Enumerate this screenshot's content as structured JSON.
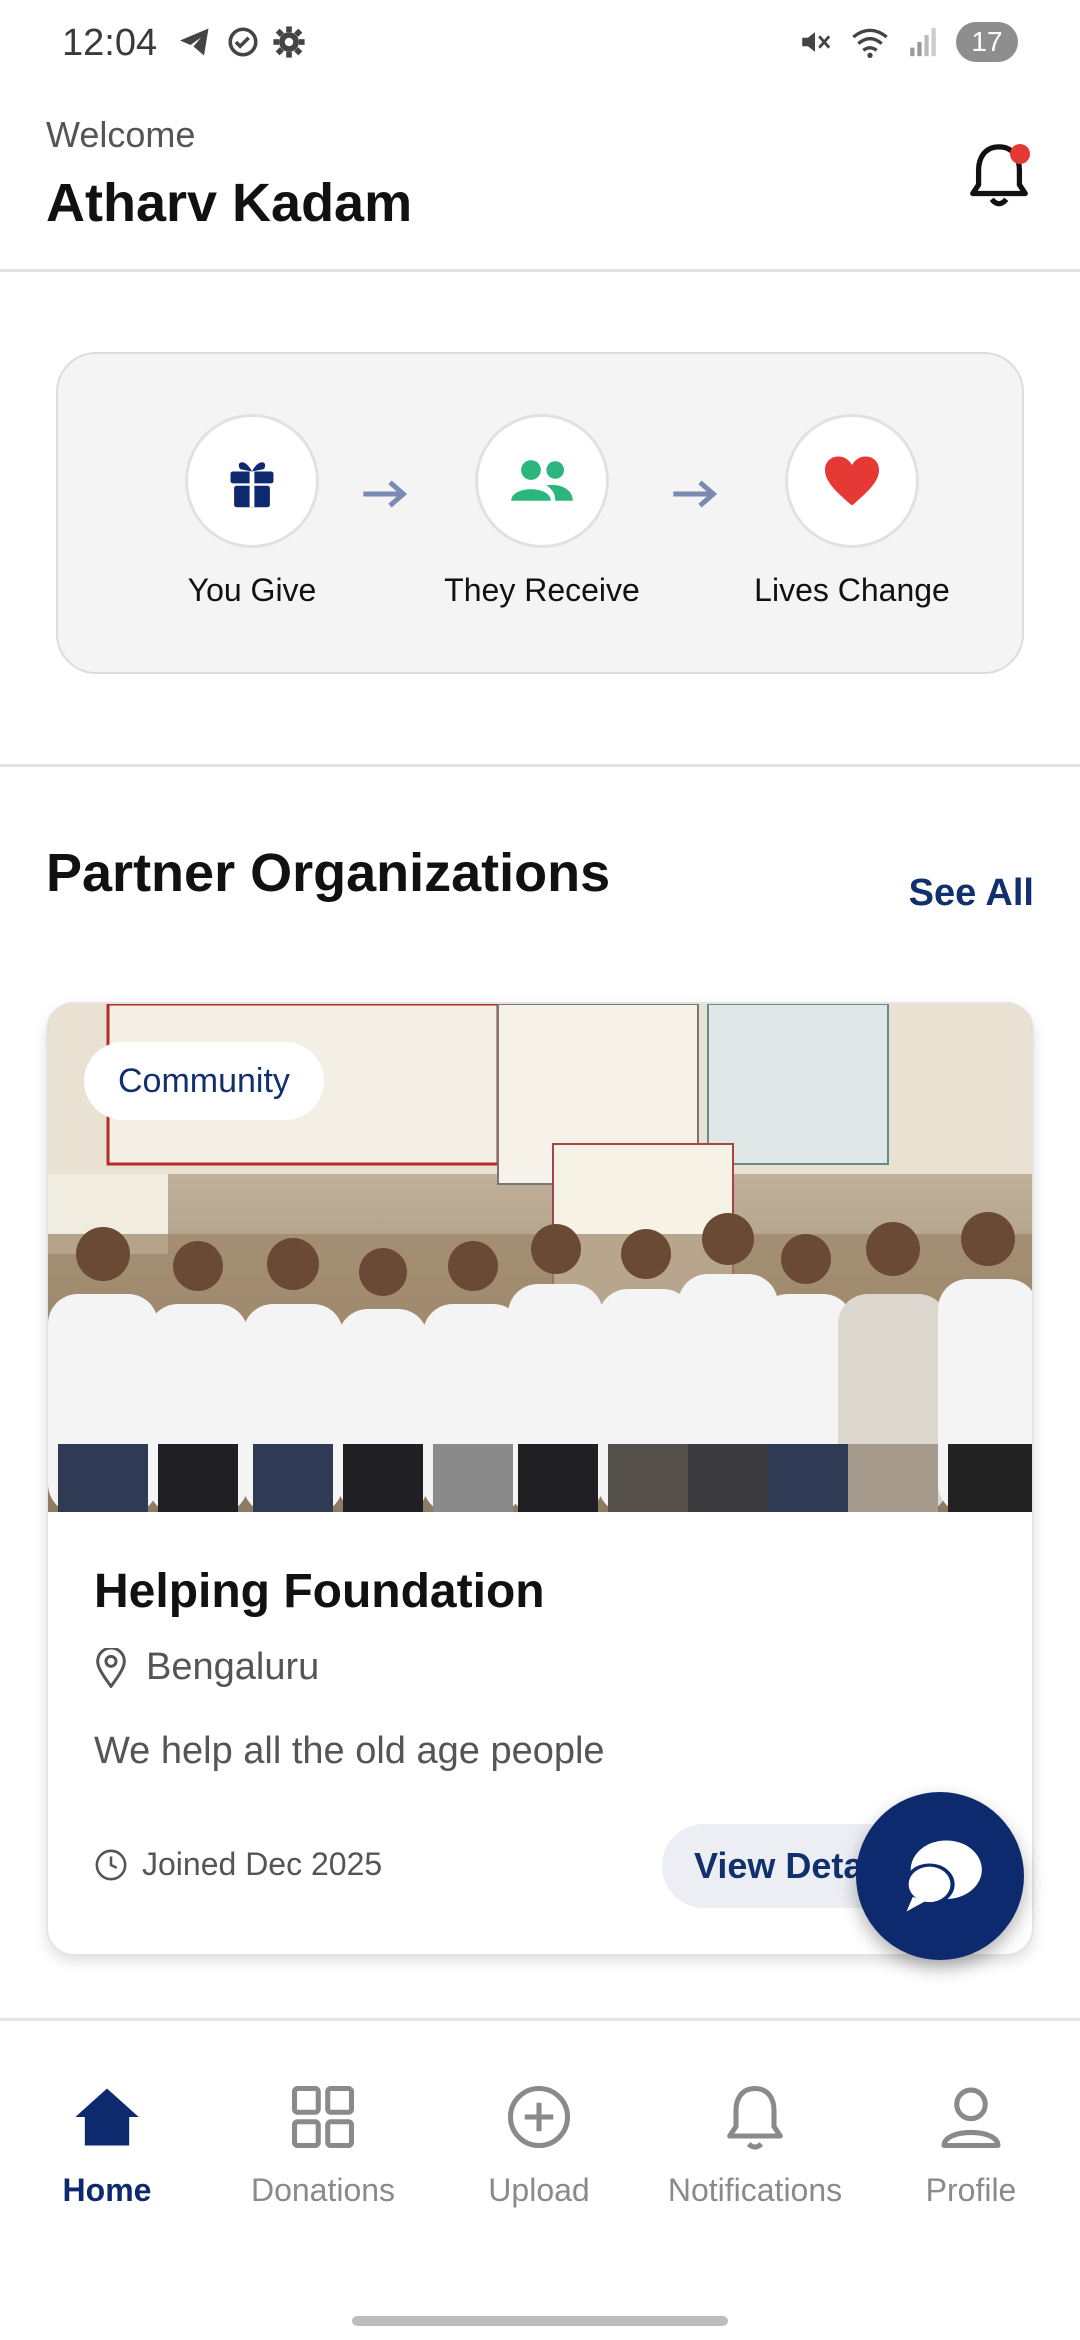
{
  "status_bar": {
    "time": "12:04",
    "battery": "17",
    "left_icons": [
      "telegram-icon",
      "check-circle-icon",
      "settings-gear-icon"
    ],
    "right_icons": [
      "mute-icon",
      "wifi-icon",
      "signal-icon"
    ]
  },
  "header": {
    "welcome": "Welcome",
    "user_name": "Atharv Kadam",
    "notification_icon": "bell-icon",
    "has_unread": true
  },
  "flow": {
    "steps": [
      {
        "label": "You Give",
        "icon": "gift-icon"
      },
      {
        "label": "They Receive",
        "icon": "people-icon"
      },
      {
        "label": "Lives Change",
        "icon": "heart-icon"
      }
    ]
  },
  "partners": {
    "title": "Partner Organizations",
    "see_all": "See All",
    "card": {
      "tag": "Community",
      "name": "Helping Foundation",
      "location": "Bengaluru",
      "description": "We help all the old age people",
      "joined": "Joined Dec 2025",
      "button": "View Deta"
    }
  },
  "fab": {
    "icon": "chat-bubble-icon"
  },
  "bottom_nav": {
    "items": [
      {
        "label": "Home",
        "icon": "home-icon",
        "active": true
      },
      {
        "label": "Donations",
        "icon": "grid-icon",
        "active": false
      },
      {
        "label": "Upload",
        "icon": "plus-circle-icon",
        "active": false
      },
      {
        "label": "Notifications",
        "icon": "bell-icon",
        "active": false
      },
      {
        "label": "Profile",
        "icon": "person-icon",
        "active": false
      }
    ]
  },
  "colors": {
    "primary": "#0e2a6e",
    "accent_green": "#2bb67d",
    "heart_red": "#e53935"
  }
}
